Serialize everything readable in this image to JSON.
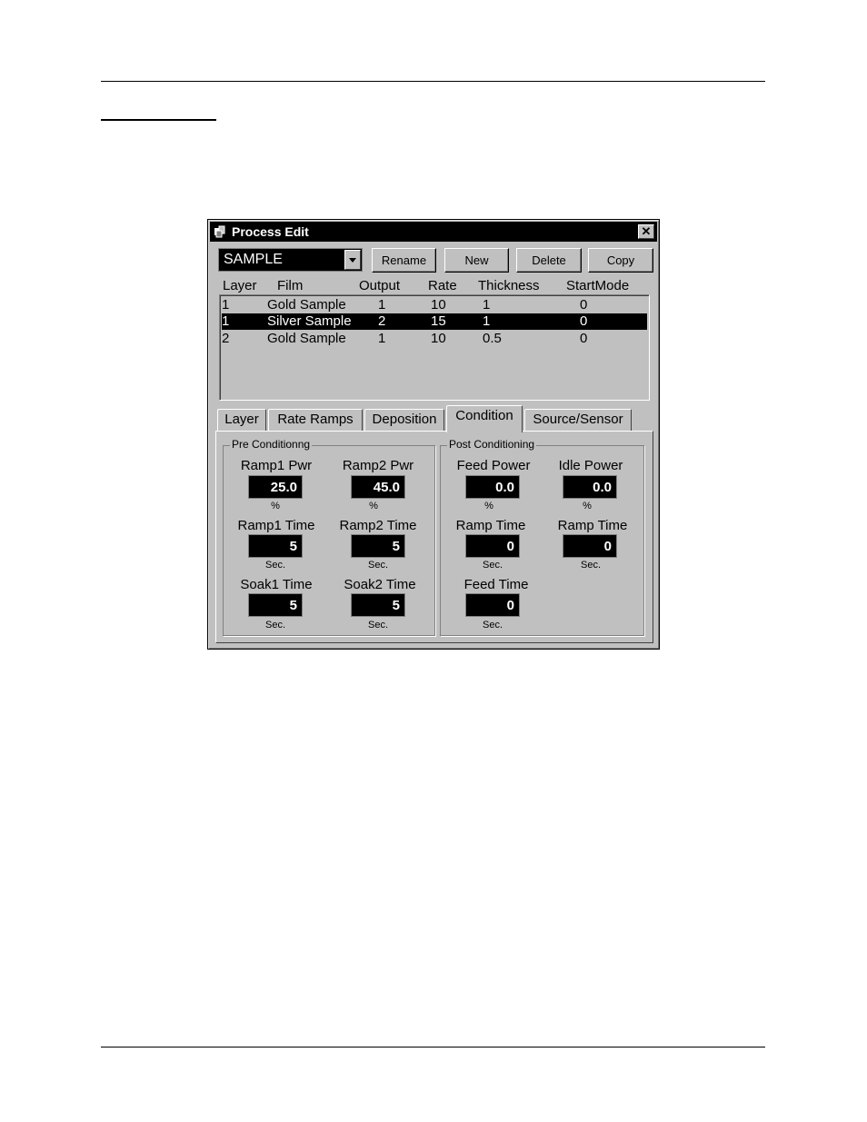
{
  "window": {
    "title": "Process Edit",
    "close_label": "✕"
  },
  "process": {
    "selected": "SAMPLE"
  },
  "buttons": {
    "rename": "Rename",
    "new": "New",
    "delete": "Delete",
    "copy": "Copy"
  },
  "list": {
    "headers": [
      "Layer",
      "Film",
      "Output",
      "Rate",
      "Thickness",
      "StartMode"
    ],
    "rows": [
      [
        "1",
        "Gold Sample",
        "1",
        "10",
        "1",
        "0"
      ],
      [
        "1",
        "Silver Sample",
        "2",
        "15",
        "1",
        "0"
      ],
      [
        "2",
        "Gold Sample",
        "1",
        "10",
        "0.5",
        "0"
      ]
    ],
    "selected_row": 1
  },
  "tabs": [
    "Layer",
    "Rate Ramps",
    "Deposition",
    "Condition",
    "Source/Sensor"
  ],
  "active_tab": "Condition",
  "pre": {
    "title": "Pre Conditionng",
    "ramp1_pwr": {
      "label": "Ramp1 Pwr",
      "value": "25.0",
      "unit": "%"
    },
    "ramp2_pwr": {
      "label": "Ramp2 Pwr",
      "value": "45.0",
      "unit": "%"
    },
    "ramp1_time": {
      "label": "Ramp1 Time",
      "value": "5",
      "unit": "Sec."
    },
    "ramp2_time": {
      "label": "Ramp2 Time",
      "value": "5",
      "unit": "Sec."
    },
    "soak1_time": {
      "label": "Soak1 Time",
      "value": "5",
      "unit": "Sec."
    },
    "soak2_time": {
      "label": "Soak2 Time",
      "value": "5",
      "unit": "Sec."
    }
  },
  "post": {
    "title": "Post Conditioning",
    "feed_power": {
      "label": "Feed Power",
      "value": "0.0",
      "unit": "%"
    },
    "idle_power": {
      "label": "Idle Power",
      "value": "0.0",
      "unit": "%"
    },
    "feed_ramp_time": {
      "label": "Ramp Time",
      "value": "0",
      "unit": "Sec."
    },
    "idle_ramp_time": {
      "label": "Ramp Time",
      "value": "0",
      "unit": "Sec."
    },
    "feed_time": {
      "label": "Feed Time",
      "value": "0",
      "unit": "Sec."
    }
  }
}
